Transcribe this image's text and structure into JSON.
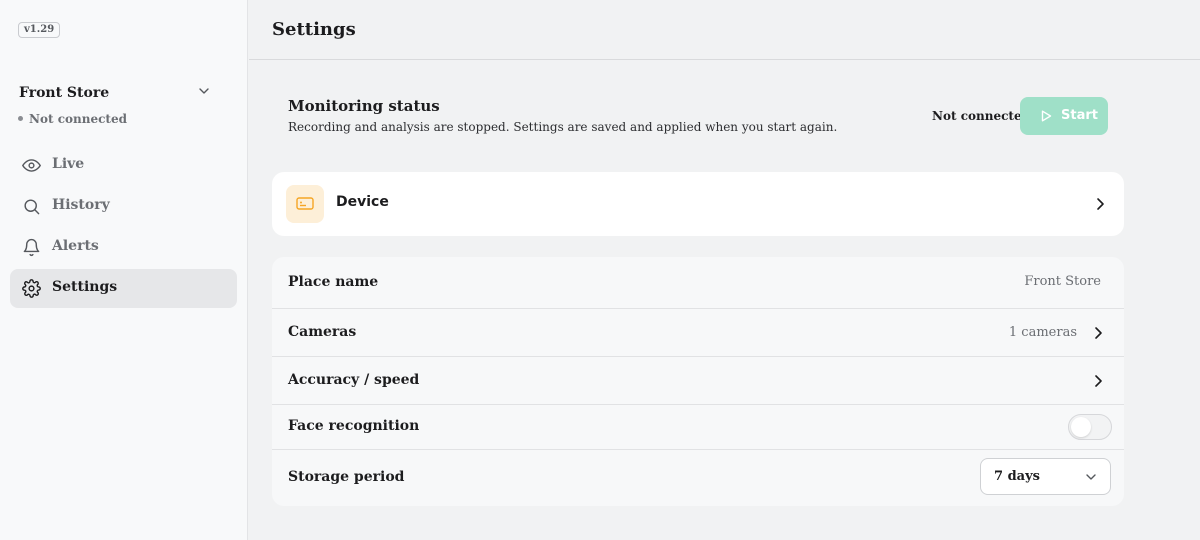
{
  "app": {
    "version": "v1.29"
  },
  "sidebar": {
    "place_name": "Front Store",
    "connection_status": "Not connected",
    "items": [
      {
        "label": "Live",
        "icon": "eye-icon"
      },
      {
        "label": "History",
        "icon": "search-icon"
      },
      {
        "label": "Alerts",
        "icon": "bell-icon"
      },
      {
        "label": "Settings",
        "icon": "gear-icon",
        "active": true
      }
    ]
  },
  "header": {
    "title": "Settings"
  },
  "monitoring": {
    "title": "Monitoring status",
    "description": "Recording and analysis are stopped. Settings are saved and applied when you start again.",
    "status": "Not connected",
    "start_label": "Start"
  },
  "device": {
    "label": "Device",
    "icon": "device-icon"
  },
  "settings": {
    "place_name": {
      "label": "Place name",
      "value": "Front Store"
    },
    "cameras": {
      "label": "Cameras",
      "value": "1 cameras"
    },
    "accuracy": {
      "label": "Accuracy / speed"
    },
    "face_recognition": {
      "label": "Face recognition",
      "enabled": false
    },
    "storage": {
      "label": "Storage period",
      "value": "7 days"
    }
  },
  "colors": {
    "accent": "#9fe0c8",
    "device_icon_bg": "#fdefd8",
    "device_icon": "#f5a524",
    "sidebar_active": "#e6e7e9"
  }
}
